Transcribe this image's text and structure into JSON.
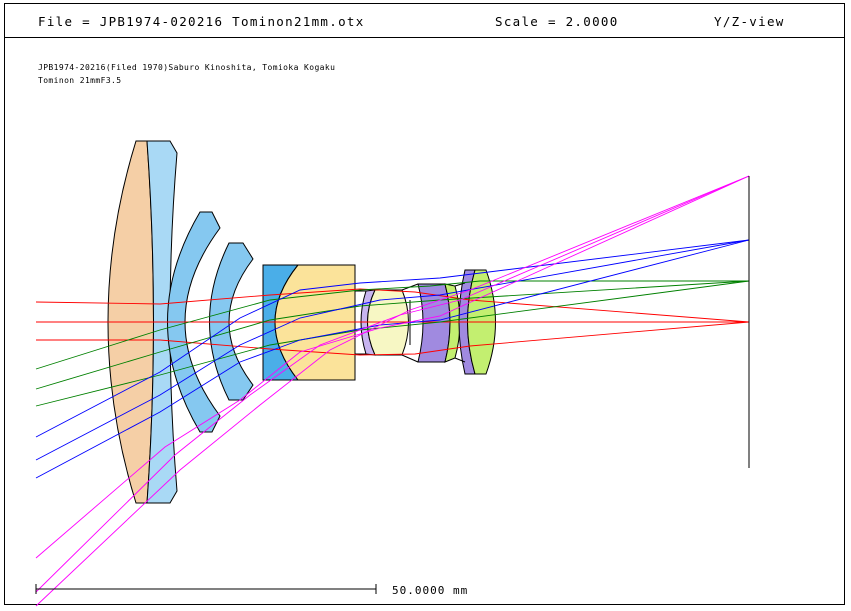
{
  "header": {
    "file": "File = JPB1974-020216 Tominon21mm.otx",
    "scale": "Scale = 2.0000",
    "view": "Y/Z-view"
  },
  "description": {
    "line1": "JPB1974-20216(Filed 1970)Saburo Kinoshita, Tomioka Kogaku",
    "line2": "Tominon 21mmF3.5"
  },
  "scale_bar": {
    "label": "50.0000 mm"
  },
  "colors": {
    "ray_axial": "#ff0000",
    "ray_mid": "#008000",
    "ray_upper": "#0000ff",
    "ray_edge": "#ff00ff",
    "glass_orange": "#f5cfa6",
    "glass_lightblue": "#a9d9f5",
    "glass_blue": "#85c8f0",
    "glass_deepblue": "#4aaee8",
    "glass_yellow": "#fbe39a",
    "glass_lavender": "#c7b4f0",
    "glass_purple": "#a08ae0",
    "glass_green": "#c3ef70",
    "glass_paleyellow": "#f7f7c4"
  }
}
